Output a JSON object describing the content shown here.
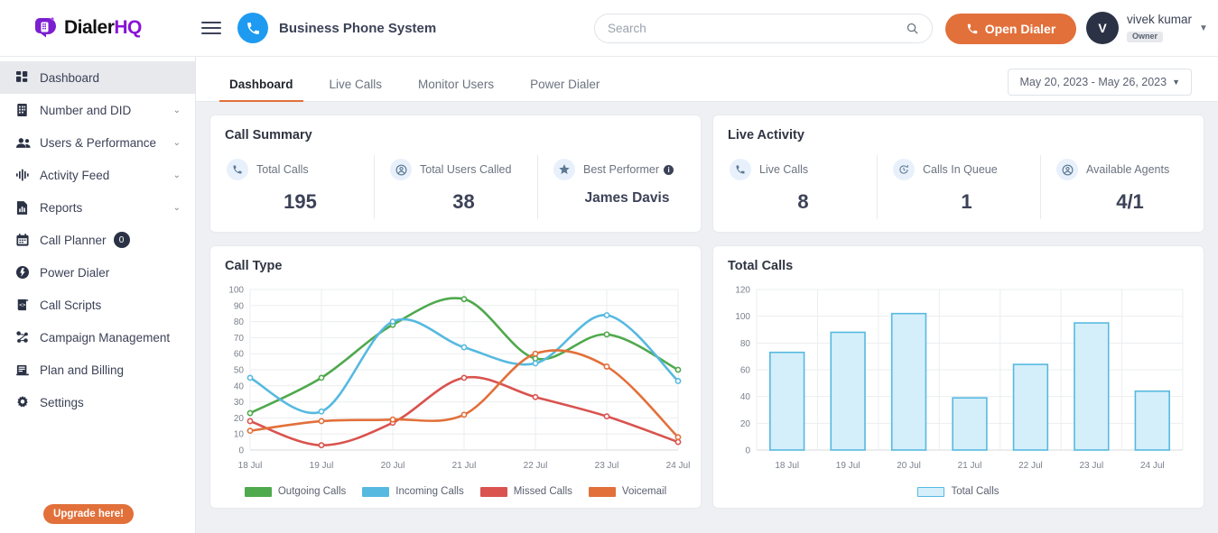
{
  "brand": {
    "name_main": "Dialer",
    "name_accent": "HQ",
    "logo_icon": "dialer-logo-icon"
  },
  "header": {
    "menu_icon": "hamburger-menu-icon",
    "app_icon": "phone-ring-icon",
    "app_title": "Business Phone System",
    "search": {
      "placeholder": "Search",
      "value": "",
      "icon": "search-icon"
    },
    "open_dialer": {
      "label": "Open Dialer",
      "icon": "phone-icon",
      "color": "#e2703a"
    },
    "user": {
      "initial": "V",
      "name": "vivek kumar",
      "role": "Owner",
      "caret_icon": "chevron-down-icon"
    }
  },
  "sidebar": {
    "items": [
      {
        "label": "Dashboard",
        "icon": "grid-dashboard-icon",
        "active": true,
        "expandable": false
      },
      {
        "label": "Number and DID",
        "icon": "keypad-icon",
        "active": false,
        "expandable": true
      },
      {
        "label": "Users & Performance",
        "icon": "users-icon",
        "active": false,
        "expandable": true
      },
      {
        "label": "Activity Feed",
        "icon": "waveform-icon",
        "active": false,
        "expandable": true
      },
      {
        "label": "Reports",
        "icon": "report-chart-icon",
        "active": false,
        "expandable": true
      },
      {
        "label": "Call Planner",
        "icon": "calendar-icon",
        "active": false,
        "expandable": false,
        "badge": "0"
      },
      {
        "label": "Power Dialer",
        "icon": "power-icon",
        "active": false,
        "expandable": false
      },
      {
        "label": "Call Scripts",
        "icon": "script-code-icon",
        "active": false,
        "expandable": false
      },
      {
        "label": "Campaign Management",
        "icon": "campaign-nodes-icon",
        "active": false,
        "expandable": false
      },
      {
        "label": "Plan and Billing",
        "icon": "billing-icon",
        "active": false,
        "expandable": false
      },
      {
        "label": "Settings",
        "icon": "gear-icon",
        "active": false,
        "expandable": false
      }
    ],
    "upgrade_label": "Upgrade here!"
  },
  "tabs": [
    {
      "label": "Dashboard",
      "active": true
    },
    {
      "label": "Live Calls",
      "active": false
    },
    {
      "label": "Monitor Users",
      "active": false
    },
    {
      "label": "Power Dialer",
      "active": false
    }
  ],
  "date_range": {
    "text": "May 20, 2023  -  May 26, 2023",
    "caret_icon": "chevron-down-icon"
  },
  "call_summary": {
    "title": "Call Summary",
    "stats": [
      {
        "label": "Total Calls",
        "value": "195",
        "icon": "phone-icon",
        "info": false
      },
      {
        "label": "Total Users Called",
        "value": "38",
        "icon": "user-circle-icon",
        "info": false
      },
      {
        "label": "Best Performer",
        "value": "James Davis",
        "icon": "star-icon",
        "info": true
      }
    ]
  },
  "live_activity": {
    "title": "Live Activity",
    "stats": [
      {
        "label": "Live Calls",
        "value": "8",
        "icon": "phone-ring-icon",
        "info": false
      },
      {
        "label": "Calls In Queue",
        "value": "1",
        "icon": "queue-clock-icon",
        "info": false
      },
      {
        "label": "Available Agents",
        "value": "4/1",
        "icon": "user-circle-icon",
        "info": false
      }
    ]
  },
  "chart_data": [
    {
      "id": "call-type",
      "type": "line",
      "title": "Call Type",
      "x": [
        "18 Jul",
        "19 Jul",
        "20 Jul",
        "21 Jul",
        "22 Jul",
        "23 Jul",
        "24 Jul"
      ],
      "xlabel": "",
      "ylabel": "",
      "ylim": [
        0,
        100
      ],
      "yticks": [
        0,
        10,
        20,
        30,
        40,
        50,
        60,
        70,
        80,
        90,
        100
      ],
      "grid": true,
      "legend_position": "bottom",
      "series": [
        {
          "name": "Outgoing Calls",
          "color": "#4fa94d",
          "values": [
            23,
            45,
            78,
            94,
            57,
            72,
            50
          ]
        },
        {
          "name": "Incoming Calls",
          "color": "#56b9e0",
          "values": [
            45,
            24,
            80,
            64,
            54,
            84,
            43
          ]
        },
        {
          "name": "Missed Calls",
          "color": "#d9534f",
          "values": [
            18,
            3,
            17,
            45,
            33,
            21,
            5
          ]
        },
        {
          "name": "Voicemail",
          "color": "#e2703a",
          "values": [
            12,
            18,
            19,
            22,
            60,
            52,
            8
          ]
        }
      ]
    },
    {
      "id": "total-calls",
      "type": "bar",
      "title": "Total Calls",
      "categories": [
        "18 Jul",
        "19 Jul",
        "20 Jul",
        "21 Jul",
        "22 Jul",
        "23 Jul",
        "24 Jul"
      ],
      "values": [
        73,
        88,
        102,
        39,
        64,
        95,
        44
      ],
      "series_name": "Total Calls",
      "bar_fill": "#d5effa",
      "bar_stroke": "#56b9e0",
      "xlabel": "",
      "ylabel": "",
      "ylim": [
        0,
        120
      ],
      "yticks": [
        0,
        20,
        40,
        60,
        80,
        100,
        120
      ],
      "grid": true,
      "legend_position": "bottom"
    }
  ]
}
